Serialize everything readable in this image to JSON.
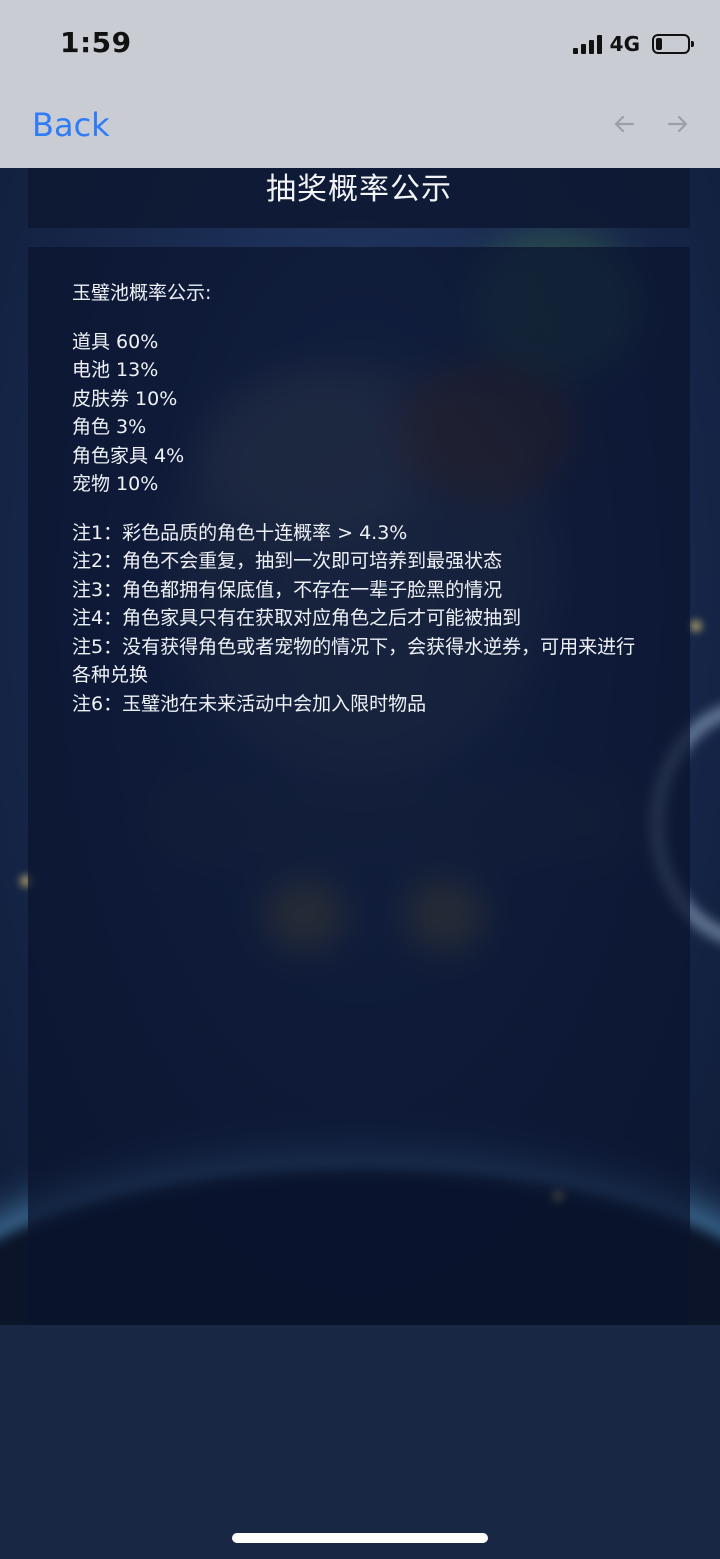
{
  "status_bar": {
    "time": "1:59",
    "network": "4G",
    "battery_level": 0.2
  },
  "nav": {
    "back_label": "Back",
    "back_arrow_icon": "arrow-left-icon",
    "forward_arrow_icon": "arrow-right-icon"
  },
  "header": {
    "title": "抽奖概率公示"
  },
  "content": {
    "heading": "玉璧池概率公示:",
    "probabilities": [
      "道具 60%",
      "电池 13%",
      "皮肤券 10%",
      "角色 3%",
      "角色家具 4%",
      "宠物 10%"
    ],
    "notes": [
      "注1：彩色品质的角色十连概率 > 4.3%",
      "注2：角色不会重复，抽到一次即可培养到最强状态",
      "注3：角色都拥有保底值，不存在一辈子脸黑的情况",
      "注4：角色家具只有在获取对应角色之后才可能被抽到",
      "注5：没有获得角色或者宠物的情况下，会获得水逆券，可用来进行各种兑换",
      "注6：玉璧池在未来活动中会加入限时物品"
    ]
  },
  "colors": {
    "link_blue": "#2f7cf6",
    "top_bar_gray": "#c9ccd3",
    "panel_dark": "#0a142e",
    "bottom_navy": "#172744"
  }
}
